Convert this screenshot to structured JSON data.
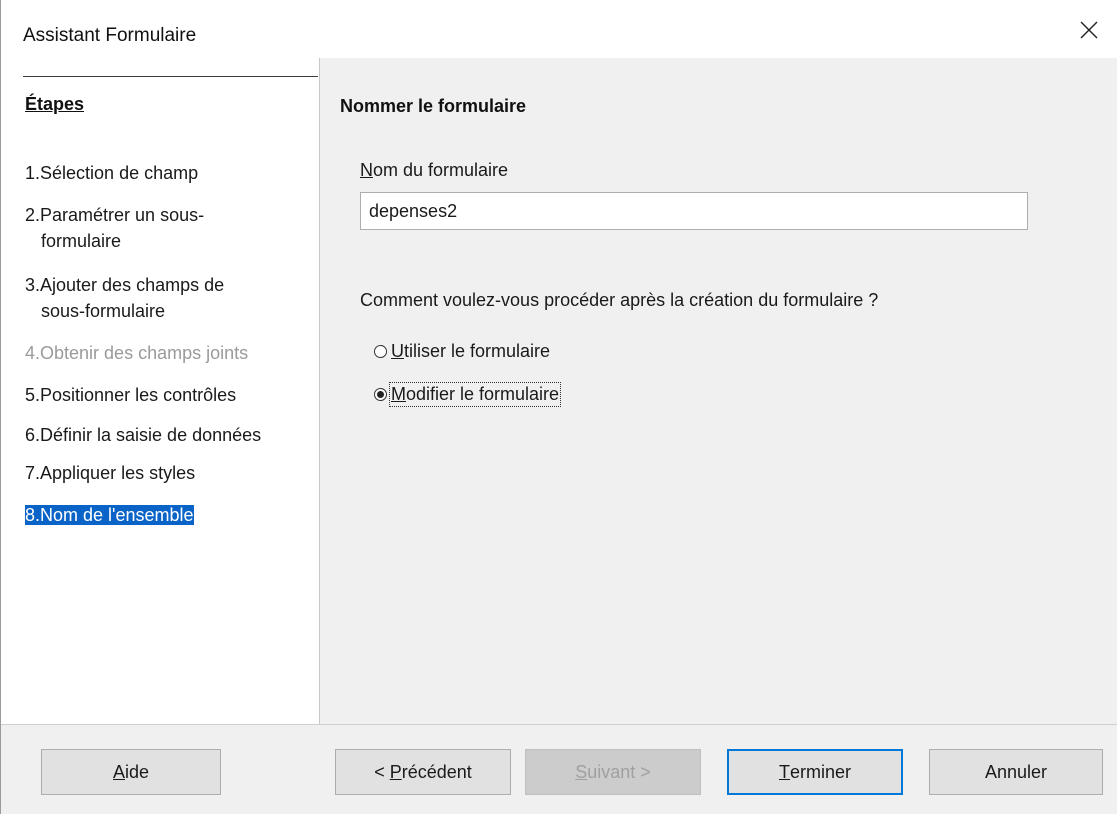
{
  "window": {
    "title": "Assistant Formulaire",
    "close_glyph": "✕"
  },
  "sidebar": {
    "heading": "Étapes",
    "steps": [
      {
        "num": "1.",
        "label": "Sélection de champ"
      },
      {
        "num": "2.",
        "label": "Paramétrer un sous-",
        "label2": "formulaire"
      },
      {
        "num": "3.",
        "label": "Ajouter des champs de",
        "label2": "sous-formulaire"
      },
      {
        "num": "4.",
        "label": "Obtenir des champs joints"
      },
      {
        "num": "5.",
        "label": "Positionner les contrôles"
      },
      {
        "num": "6.",
        "label": "Définir la saisie de données"
      },
      {
        "num": "7.",
        "label": "Appliquer les styles"
      },
      {
        "num": "8.",
        "label": "Nom de l'ensemble"
      }
    ]
  },
  "main": {
    "heading": "Nommer le formulaire",
    "name_label_mnemonic": "N",
    "name_label_rest": "om du formulaire",
    "name_value": "depenses2",
    "question": "Comment voulez-vous procéder après la création du formulaire ?",
    "options": [
      {
        "mnemonic": "U",
        "rest": "tiliser le formulaire",
        "checked": false
      },
      {
        "mnemonic": "M",
        "rest": "odifier le formulaire",
        "checked": true
      }
    ]
  },
  "footer": {
    "help": {
      "mnemonic": "A",
      "rest": "ide"
    },
    "back": {
      "prefix": "< ",
      "mnemonic": "P",
      "rest": "récédent"
    },
    "next": {
      "mnemonic": "S",
      "rest": "uivant >"
    },
    "finish": {
      "mnemonic": "T",
      "rest": "erminer"
    },
    "cancel": "Annuler"
  }
}
